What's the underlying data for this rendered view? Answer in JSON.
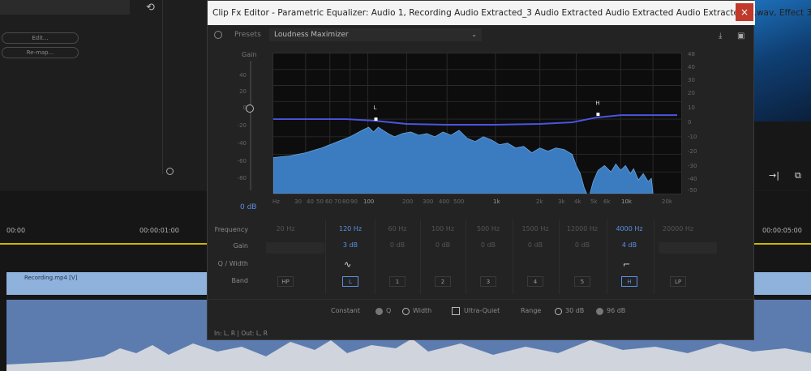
{
  "background": {
    "left_buttons": [
      "Edit...",
      "Re-map..."
    ],
    "undo_icon": "undo-icon",
    "timecodes": [
      "00:00",
      "00:00:01:00",
      "00:00:05:00"
    ],
    "video_track_label": "Recording.mp4 [V]"
  },
  "editor": {
    "title": "Clip Fx Editor - Parametric Equalizer: Audio 1, Recording Audio Extracted_3 Audio Extracted Audio Extracted Audio Extracted_3.wav, Effect 3,...",
    "close_label": "×",
    "presets_label": "Presets",
    "preset_value": "Loudness Maximizer",
    "gain_label": "Gain",
    "gain_ticks": [
      "40",
      "20",
      "0",
      "-20",
      "-40",
      "-60",
      "-80"
    ],
    "gain_value": "0 dB",
    "right_ticks": [
      "48",
      "40",
      "30",
      "20",
      "10",
      "0",
      "-10",
      "-20",
      "-30",
      "-40",
      "-50"
    ],
    "freq_ticks": [
      "Hz",
      "30",
      "40",
      "50",
      "60",
      "70",
      "80",
      "90",
      "100",
      "200",
      "300",
      "400",
      "500",
      "1k",
      "2k",
      "3k",
      "4k",
      "5k",
      "6k",
      "10k",
      "20k"
    ],
    "markers": {
      "low": "L",
      "high": "H"
    },
    "row_labels": [
      "Frequency",
      "Gain",
      "Q / Width",
      "Band"
    ],
    "bands": [
      {
        "name": "HP",
        "freq": "20 Hz",
        "gain": "",
        "active": false
      },
      {
        "name": "L",
        "freq": "120 Hz",
        "gain": "3 dB",
        "active": true
      },
      {
        "name": "1",
        "freq": "60 Hz",
        "gain": "0 dB",
        "active": false
      },
      {
        "name": "2",
        "freq": "100 Hz",
        "gain": "0 dB",
        "active": false
      },
      {
        "name": "3",
        "freq": "500 Hz",
        "gain": "0 dB",
        "active": false
      },
      {
        "name": "4",
        "freq": "1500 Hz",
        "gain": "0 dB",
        "active": false
      },
      {
        "name": "5",
        "freq": "12000 Hz",
        "gain": "0 dB",
        "active": false
      },
      {
        "name": "H",
        "freq": "4000 Hz",
        "gain": "4 dB",
        "active": true
      },
      {
        "name": "LP",
        "freq": "20000 Hz",
        "gain": "",
        "active": false
      }
    ],
    "constant_label": "Constant",
    "constant_options": [
      "Q",
      "Width"
    ],
    "ultra_quiet_label": "Ultra-Quiet",
    "range_label": "Range",
    "range_options": [
      "30 dB",
      "96 dB"
    ],
    "io_label": "In: L, R | Out: L, R"
  },
  "colors": {
    "accent": "#5b8fe0",
    "curve": "#4a55e0",
    "spectrum": "#3b7bbf",
    "timeline_ruler": "#c9b800"
  }
}
